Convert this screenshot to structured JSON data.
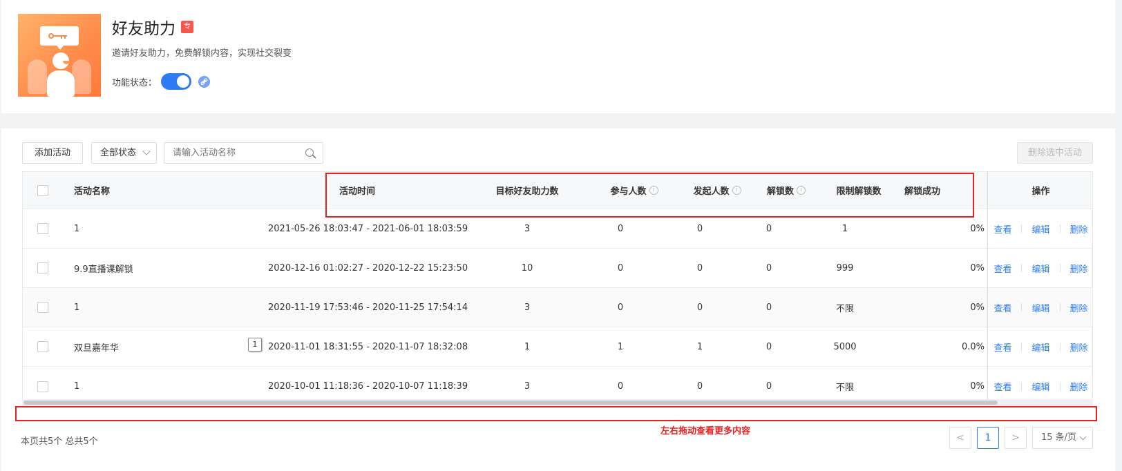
{
  "header": {
    "title": "好友助力",
    "badge": "专",
    "subtitle": "邀请好友助力，免费解锁内容，实现社交裂变",
    "status_label": "功能状态：",
    "status_on": true
  },
  "toolbar": {
    "add_label": "添加活动",
    "status_filter": "全部状态",
    "search_placeholder": "请输入活动名称",
    "delete_label": "删除选中活动"
  },
  "table": {
    "columns": [
      "活动名称",
      "活动时间",
      "目标好友助力数",
      "参与人数",
      "发起人数",
      "解锁数",
      "限制解锁数",
      "解锁成功",
      "操作"
    ],
    "rows": [
      {
        "name": "1",
        "time": "2021-05-26 18:03:47 - 2021-06-01 18:03:59",
        "target": "3",
        "participants": "0",
        "initiators": "0",
        "unlocks": "0",
        "limit": "1",
        "rate": "0%"
      },
      {
        "name": "9.9直播课解锁",
        "time": "2020-12-16 01:02:27 - 2020-12-22 15:23:50",
        "target": "10",
        "participants": "0",
        "initiators": "0",
        "unlocks": "0",
        "limit": "999",
        "rate": "0%"
      },
      {
        "name": "1",
        "time": "2020-11-19 17:53:46 - 2020-11-25 17:54:14",
        "target": "3",
        "participants": "0",
        "initiators": "0",
        "unlocks": "0",
        "limit": "不限",
        "rate": "0%"
      },
      {
        "name": "双旦嘉年华",
        "time": "2020-11-01 18:31:55 - 2020-11-07 18:32:08",
        "target": "1",
        "participants": "1",
        "initiators": "1",
        "unlocks": "0",
        "limit": "5000",
        "rate": "0.0%"
      },
      {
        "name": "1",
        "time": "2020-10-01 11:18:36 - 2020-10-07 11:18:39",
        "target": "3",
        "participants": "0",
        "initiators": "0",
        "unlocks": "0",
        "limit": "不限",
        "rate": "0%"
      }
    ],
    "actions": {
      "view": "查看",
      "edit": "编辑",
      "delete": "删除"
    },
    "tooltip": "1"
  },
  "annotation": "左右拖动查看更多内容",
  "footer": {
    "count_text": "本页共5个 总共5个",
    "prev": "<",
    "page": "1",
    "next": ">",
    "page_size": "15 条/页"
  },
  "colors": {
    "accent": "#2d7cf6",
    "annotation": "#e52121",
    "badge": "#f5584b"
  }
}
